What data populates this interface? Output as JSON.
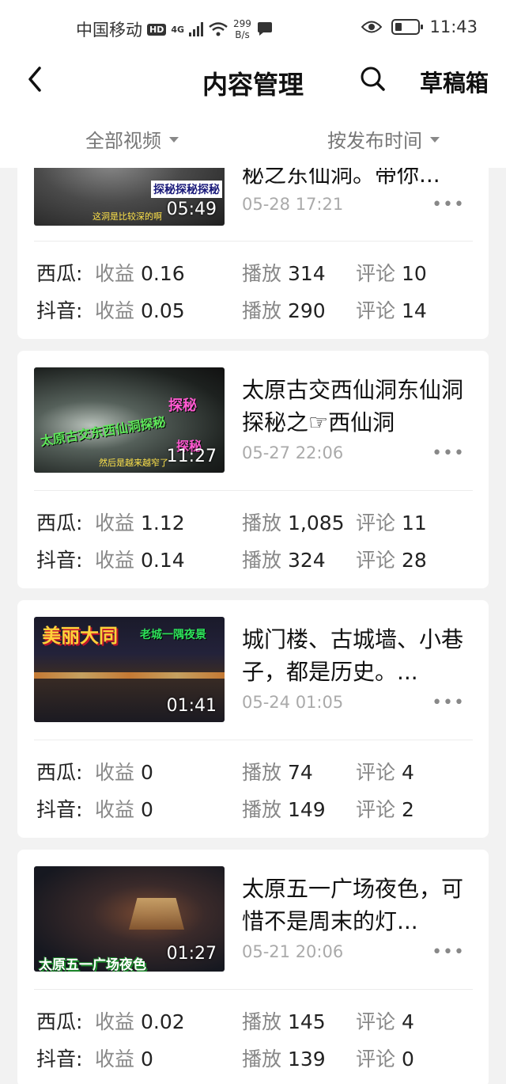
{
  "status": {
    "carrier": "中国移动",
    "hd": "HD",
    "network": "4G",
    "speed_value": "299",
    "speed_unit": "B/s",
    "time": "11:43"
  },
  "header": {
    "title": "内容管理",
    "drafts": "草稿箱"
  },
  "filters": {
    "category": "全部视频",
    "sort": "按发布时间"
  },
  "labels": {
    "platform_xigua": "西瓜:",
    "platform_douyin": "抖音:",
    "income": "收益",
    "plays": "播放",
    "comments": "评论",
    "more": "•••"
  },
  "videos": [
    {
      "title": "秘之东仙洞。带你...",
      "date": "05-28 17:21",
      "duration": "05:49",
      "thumb_caption": "探秘探秘探秘",
      "thumb_sub": "这洞是比较深的啊",
      "xigua": {
        "income": "0.16",
        "plays": "314",
        "comments": "10"
      },
      "douyin": {
        "income": "0.05",
        "plays": "290",
        "comments": "14"
      }
    },
    {
      "title": "太原古交西仙洞东仙洞探秘之☞西仙洞",
      "date": "05-27 22:06",
      "duration": "11:27",
      "thumb_caption": "太原古交东西仙洞探秘",
      "thumb_tag": "探秘",
      "thumb_tag2": "探秘",
      "thumb_sub": "然后是越来越窄了",
      "xigua": {
        "income": "1.12",
        "plays": "1,085",
        "comments": "11"
      },
      "douyin": {
        "income": "0.14",
        "plays": "324",
        "comments": "28"
      }
    },
    {
      "title": "城门楼、古城墙、小巷子，都是历史。...",
      "date": "05-24 01:05",
      "duration": "01:41",
      "thumb_caption": "美丽大同",
      "thumb_tag": "老城一隅夜景",
      "xigua": {
        "income": "0",
        "plays": "74",
        "comments": "4"
      },
      "douyin": {
        "income": "0",
        "plays": "149",
        "comments": "2"
      }
    },
    {
      "title": "太原五一广场夜色，可惜不是周末的灯...",
      "date": "05-21 20:06",
      "duration": "01:27",
      "thumb_caption": "太原五一广场夜色",
      "xigua": {
        "income": "0.02",
        "plays": "145",
        "comments": "4"
      },
      "douyin": {
        "income": "0",
        "plays": "139",
        "comments": "0"
      }
    }
  ]
}
